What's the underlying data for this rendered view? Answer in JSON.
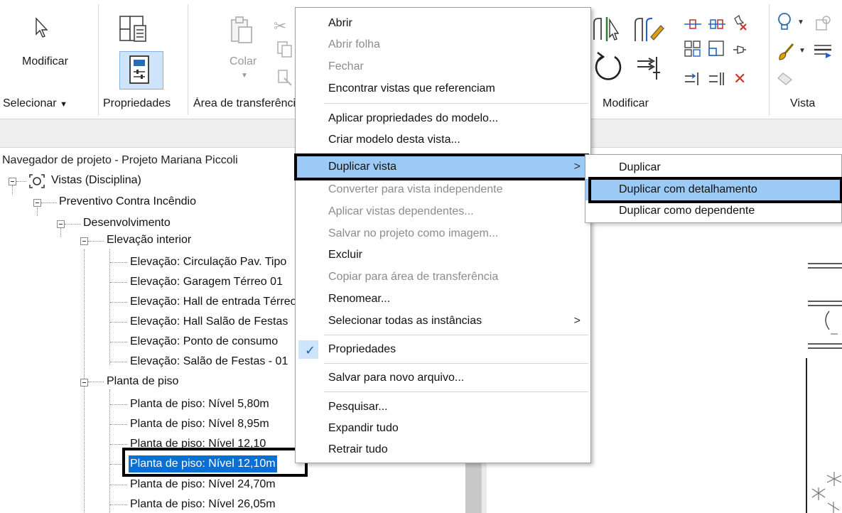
{
  "ribbon": {
    "modificar_button": "Modificar",
    "colar_button": "Colar",
    "panels": {
      "selecionar": "Selecionar",
      "propriedades": "Propriedades",
      "area_transferencia": "Área de transferência",
      "modificar": "Modificar",
      "vista": "Vista"
    }
  },
  "browser": {
    "title": "Navegador de projeto - Projeto Mariana Piccoli",
    "root": "Vistas (Disciplina)",
    "discipline": "Preventivo Contra Incêndio",
    "subdiscipline": "Desenvolvimento",
    "groups": [
      {
        "label": "Elevação interior",
        "items": [
          "Elevação: Circulação Pav. Tipo",
          "Elevação: Garagem Térreo 01",
          "Elevação: Hall de entrada Térreo",
          "Elevação: Hall Salão de Festas",
          "Elevação: Ponto de consumo",
          "Elevação: Salão de Festas - 01"
        ]
      },
      {
        "label": "Planta de piso",
        "items": [
          "Planta de piso: Nível 5,80m",
          "Planta de piso: Nível 8,95m",
          "Planta de piso: Nível 12,10",
          "Planta de piso: Nível 12,10m",
          "Planta de piso: Nível 24,70m",
          "Planta de piso: Nível 26,05m"
        ]
      }
    ],
    "selected_item": "Planta de piso: Nível 12,10m"
  },
  "context_menu": {
    "items": [
      {
        "label": "Abrir",
        "enabled": true
      },
      {
        "label": "Abrir folha",
        "enabled": false
      },
      {
        "label": "Fechar",
        "enabled": false
      },
      {
        "label": "Encontrar vistas que referenciam",
        "enabled": true
      },
      {
        "label": "Aplicar propriedades do modelo...",
        "enabled": true
      },
      {
        "label": "Criar modelo desta vista...",
        "enabled": true
      },
      {
        "label": "Duplicar vista",
        "enabled": true,
        "submenu": true,
        "highlighted": true
      },
      {
        "label": "Converter para vista independente",
        "enabled": false
      },
      {
        "label": "Aplicar vistas dependentes...",
        "enabled": false
      },
      {
        "label": "Salvar no projeto como imagem...",
        "enabled": false
      },
      {
        "label": "Excluir",
        "enabled": true
      },
      {
        "label": "Copiar para área de transferência",
        "enabled": false
      },
      {
        "label": "Renomear...",
        "enabled": true
      },
      {
        "label": "Selecionar todas as instâncias",
        "enabled": true,
        "submenu": true
      },
      {
        "label": "Propriedades",
        "enabled": true,
        "checked": true
      },
      {
        "label": "Salvar para novo arquivo...",
        "enabled": true
      },
      {
        "label": "Pesquisar...",
        "enabled": true
      },
      {
        "label": "Expandir tudo",
        "enabled": true
      },
      {
        "label": "Retrair tudo",
        "enabled": true
      }
    ],
    "submenu_arrow": ">",
    "check_glyph": "✓"
  },
  "submenu": {
    "items": [
      {
        "label": "Duplicar"
      },
      {
        "label": "Duplicar com detalhamento",
        "highlighted": true
      },
      {
        "label": "Duplicar como dependente"
      }
    ]
  },
  "colors": {
    "selection": "#0a6fd4",
    "menu_highlight": "#9ccaf7",
    "annotation_box": "#000000"
  }
}
